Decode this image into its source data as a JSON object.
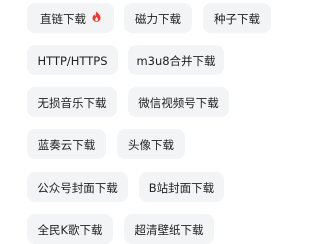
{
  "tags": [
    {
      "label": "直链下载",
      "hot": true
    },
    {
      "label": "磁力下载"
    },
    {
      "label": "种子下载"
    },
    {
      "label": "HTTP/HTTPS"
    },
    {
      "label": "m3u8合并下载"
    },
    {
      "label": "无损音乐下载"
    },
    {
      "label": "微信视频号下载"
    },
    {
      "label": "蓝奏云下载"
    },
    {
      "label": "头像下载"
    },
    {
      "label": "公众号封面下载"
    },
    {
      "label": "B站封面下载"
    },
    {
      "label": "全民K歌下载"
    },
    {
      "label": "超清壁纸下载"
    }
  ],
  "colors": {
    "chip_background": "#f3f4f6",
    "text": "#222222",
    "hot_badge": "#ef3b2d"
  },
  "icons": {
    "hot_badge": "hot-flame-icon"
  }
}
